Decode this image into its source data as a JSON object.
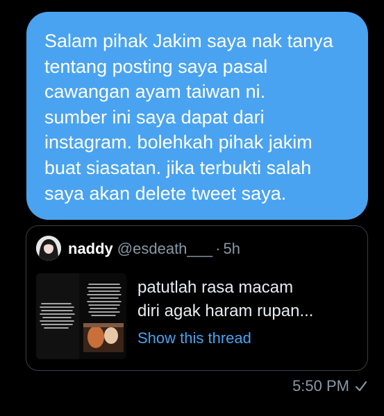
{
  "message": {
    "text": "Salam pihak Jakim saya nak tanya\ntentang posting saya pasal\ncawangan ayam taiwan ni.\nsumber ini saya dapat dari\ninstagram. bolehkah pihak jakim\nbuat siasatan. jika terbukti salah\nsaya akan delete tweet saya.",
    "bubble_color": "#4aa3f0"
  },
  "quoted_tweet": {
    "author": "naddy",
    "handle": "@esdeath___",
    "separator": "·",
    "time": "5h",
    "text": "patutlah rasa macam\ndiri agak haram rupan...",
    "link_label": "Show this thread",
    "link_color": "#4aa3f0"
  },
  "status": {
    "time": "5:50 PM",
    "icon": "check-icon"
  }
}
